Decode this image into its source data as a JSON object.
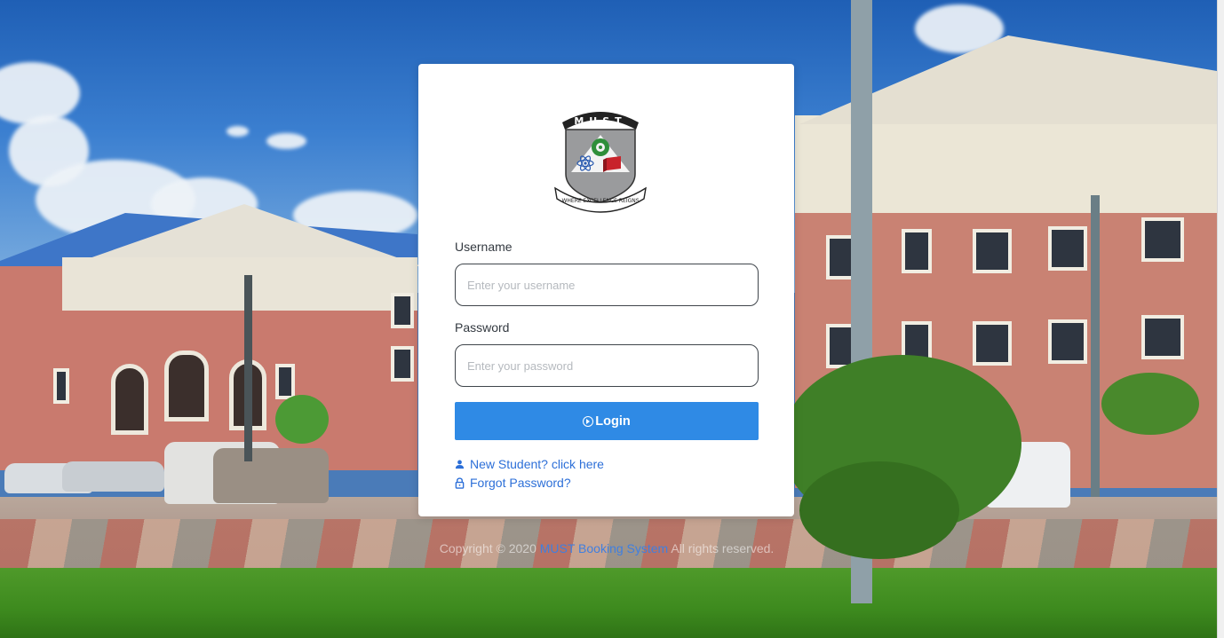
{
  "logo": {
    "name": "MUST",
    "motto": "WHERE EXCELLENCE REIGNS"
  },
  "form": {
    "username_label": "Username",
    "username_placeholder": "Enter your username",
    "password_label": "Password",
    "password_placeholder": "Enter your password",
    "login_label": "Login",
    "login_icon": "arrow-circle-right-icon"
  },
  "links": {
    "new_student": "New Student? click here",
    "new_student_icon": "person-icon",
    "forgot_password": "Forgot Password?",
    "forgot_password_icon": "lock-icon"
  },
  "footer": {
    "prefix": "Copyright © 2020",
    "brand": "MUST Booking System",
    "suffix": "All rights reserved."
  },
  "colors": {
    "accent": "#2f8ae5",
    "link": "#2c6fd8",
    "card": "#ffffff"
  }
}
